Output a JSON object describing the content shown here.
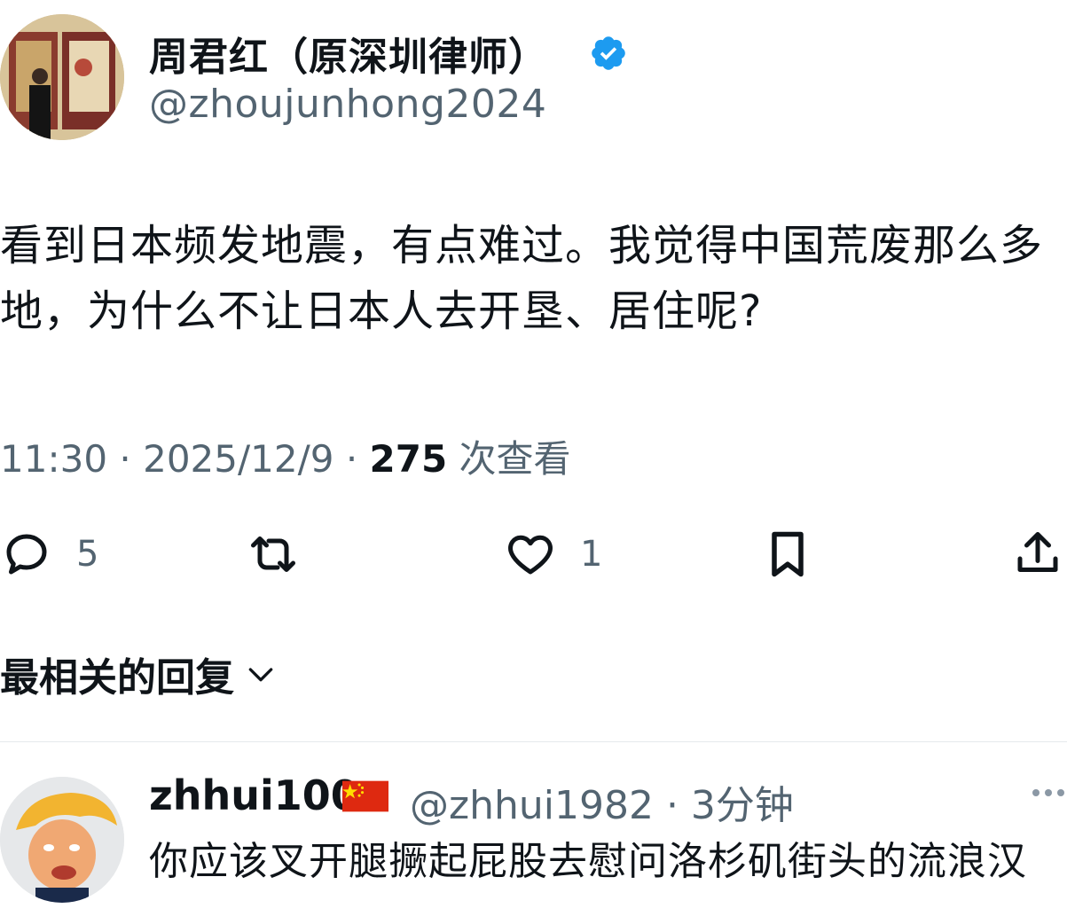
{
  "tweet": {
    "author_name": "周君红（原深圳律师）",
    "author_handle": "@zhoujunhong2024",
    "text": "看到日本频发地震，有点难过。我觉得中国荒废那么多地，为什么不让日本人去开垦、居住呢?",
    "time": "11:30",
    "date": "2025/12/9",
    "separator": " · ",
    "views_count": "275",
    "views_label": " 次查看",
    "reply_count": "5",
    "like_count": "1",
    "verified_color": "#1d9bf0"
  },
  "replies_section": {
    "label": "最相关的回复"
  },
  "reply": {
    "name": "zhhui100",
    "handle_time": "@zhhui1982 · 3分钟",
    "text": "你应该叉开腿撅起屁股去慰问洛杉矶街头的流浪汉"
  },
  "icons": {
    "reply": "reply-icon",
    "retweet": "retweet-icon",
    "like": "like-icon",
    "bookmark": "bookmark-icon",
    "share": "share-icon",
    "verified": "verified-badge-icon",
    "chevron": "chevron-down-icon",
    "flag": "china-flag-icon",
    "more": "more-dots-icon"
  }
}
